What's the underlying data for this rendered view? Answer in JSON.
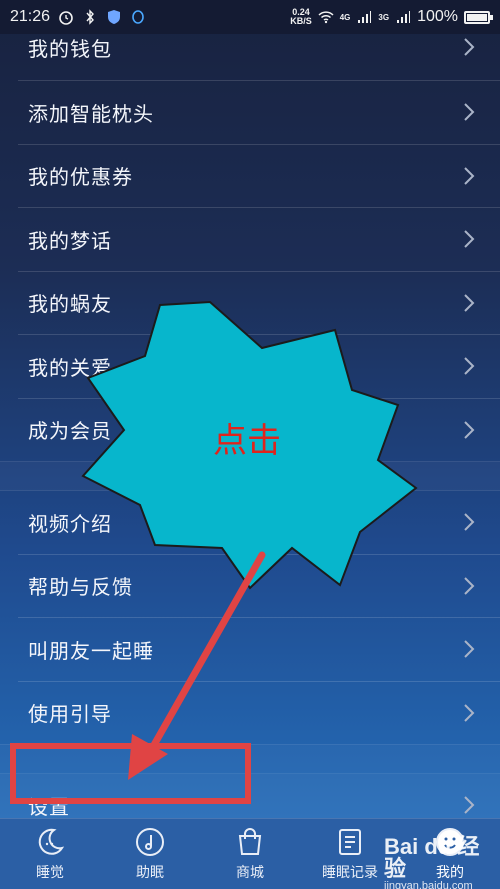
{
  "status_bar": {
    "time": "21:26",
    "net_speed_value": "0.24",
    "net_speed_unit": "KB/S",
    "network_4g": "4G",
    "network_3g": "3G",
    "battery": "100%"
  },
  "menu": {
    "group1": [
      {
        "label": "我的钱包"
      },
      {
        "label": "添加智能枕头"
      },
      {
        "label": "我的优惠券"
      },
      {
        "label": "我的梦话"
      },
      {
        "label": "我的蜗友"
      },
      {
        "label": "我的关爱"
      },
      {
        "label": "成为会员"
      }
    ],
    "group2": [
      {
        "label": "视频介绍"
      },
      {
        "label": "帮助与反馈"
      },
      {
        "label": "叫朋友一起睡"
      },
      {
        "label": "使用引导"
      }
    ],
    "group3": [
      {
        "label": "设置"
      }
    ]
  },
  "annotation": {
    "text": "点击",
    "burst_color": "#07b6cc",
    "text_color": "#e0241c",
    "arrow_color": "#e04040"
  },
  "tabbar": {
    "tabs": [
      {
        "label": "睡觉",
        "icon": "moon-icon"
      },
      {
        "label": "助眠",
        "icon": "music-note-icon"
      },
      {
        "label": "商城",
        "icon": "shopping-bag-icon"
      },
      {
        "label": "睡眠记录",
        "icon": "document-icon"
      },
      {
        "label": "我的",
        "icon": "profile-icon"
      }
    ]
  },
  "watermark": {
    "brand": "Bai du 经验",
    "url": "jingyan.baidu.com"
  }
}
